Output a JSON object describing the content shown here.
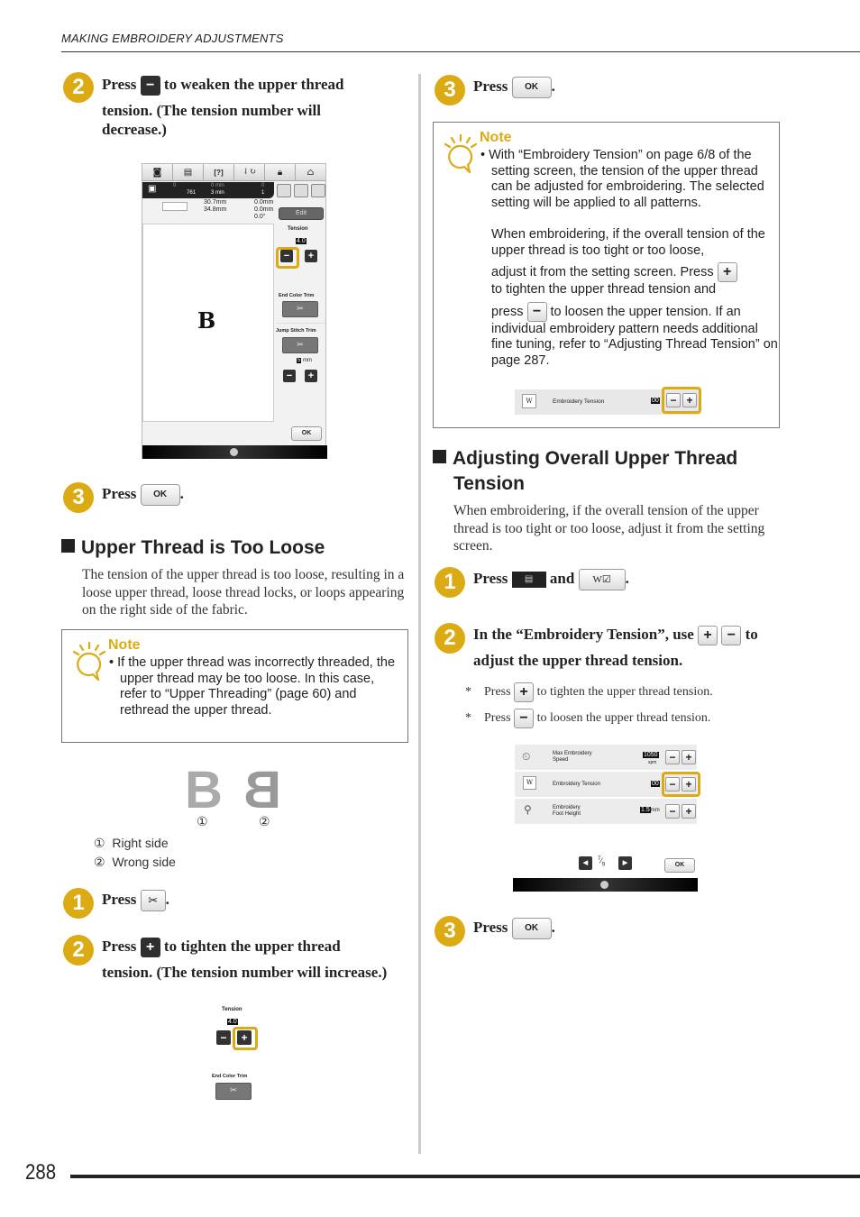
{
  "header": {
    "title": "MAKING EMBROIDERY ADJUSTMENTS"
  },
  "footer": {
    "page_number": "288"
  },
  "left": {
    "step2a": {
      "number": "2",
      "prefix": "Press",
      "icon": "minus-button",
      "line1": "to weaken the upper thread",
      "line2": "tension. (The tension number will",
      "line3": "decrease.)"
    },
    "screen1": {
      "toolbar_icons": [
        "camera-icon",
        "settings-page-icon",
        "help-icon",
        "needle-mode-icon",
        "lock-icon",
        "home-icon"
      ],
      "stitch_count_top": "0",
      "stitch_count_bottom": "761",
      "time_top": "0 min",
      "time_bottom": "3 min",
      "color_top": "0",
      "color_bottom": "1",
      "size_w": "30.7mm",
      "size_h": "34.8mm",
      "offset_v": "0.0mm",
      "offset_h": "0.0mm",
      "rotation": "0.0°",
      "edit_label": "Edit",
      "tension_label": "Tension",
      "tension_value": "4.0",
      "end_color_trim_label": "End Color Trim",
      "jump_stitch_trim_label": "Jump Stitch Trim",
      "jump_value": "5",
      "jump_unit": "mm",
      "pattern_letter": "B",
      "ok_label": "OK",
      "minus": "−",
      "plus": "+"
    },
    "step3a": {
      "number": "3",
      "prefix": "Press",
      "ok_label": "OK",
      "suffix": "."
    },
    "section_loose": {
      "title": "Upper Thread is Too Loose",
      "body": "The tension of the upper thread is too loose, resulting in a loose upper thread, loose thread locks, or loops appearing on the right side of the fabric."
    },
    "note1": {
      "label": "Note",
      "text": "If the upper thread was incorrectly threaded, the upper thread may be too loose. In this case, refer to “Upper Threading” (page 60) and rethread the upper thread."
    },
    "figure": {
      "marker1": "①",
      "marker2": "②",
      "legend": [
        {
          "marker": "①",
          "label": "Right side"
        },
        {
          "marker": "②",
          "label": "Wrong side"
        }
      ]
    },
    "step1b": {
      "number": "1",
      "prefix": "Press",
      "icon": "thread-trim-scissors-button",
      "suffix": "."
    },
    "step2b": {
      "number": "2",
      "prefix": "Press",
      "icon": "plus-button",
      "line1": "to tighten the upper thread",
      "line2": "tension. (The tension number will increase.)"
    },
    "screen2": {
      "tension_label": "Tension",
      "tension_value": "4.0",
      "end_color_trim_label": "End Color Trim",
      "minus": "−",
      "plus": "+"
    }
  },
  "right": {
    "step3c": {
      "number": "3",
      "prefix": "Press",
      "ok_label": "OK",
      "suffix": "."
    },
    "note2": {
      "label": "Note",
      "p1": "With “Embroidery Tension” on page 6/8 of the setting screen, the tension of the upper thread can be adjusted for embroidering. The selected setting will be applied to all patterns.",
      "p2a": "When embroidering, if the overall tension of the upper thread is too tight or too loose,",
      "p2b": "adjust it from the setting screen. Press",
      "p2c": "to tighten the upper thread tension and",
      "p2d": "press",
      "p2e": "to loosen the upper tension. If an",
      "p2f": "individual embroidery pattern needs additional fine tuning, refer to “Adjusting Thread Tension” on page 287.",
      "setting_row_label": "Embroidery Tension",
      "setting_row_value": "00",
      "plus": "+",
      "minus": "−"
    },
    "section_overall": {
      "title_line1": "Adjusting Overall Upper Thread",
      "title_line2": "Tension",
      "body": "When embroidering, if the overall tension of the upper thread is too tight or too loose, adjust it from the setting screen."
    },
    "step1d": {
      "number": "1",
      "prefix": "Press",
      "middle": "and",
      "suffix": "."
    },
    "step2d": {
      "number": "2",
      "line1_a": "In the “Embroidery Tension”, use",
      "line1_b": "to",
      "line2": "adjust the upper thread tension.",
      "bullets": [
        {
          "star": "*",
          "prefix": "Press",
          "icon": "+",
          "text": "to tighten the upper thread tension."
        },
        {
          "star": "*",
          "prefix": "Press",
          "icon": "−",
          "text": "to loosen the upper thread tension."
        }
      ]
    },
    "settings_screen": {
      "rows": [
        {
          "label_line1": "Max Embroidery",
          "label_line2": "Speed",
          "value": "1050",
          "unit": "spm"
        },
        {
          "label_line1": "Embroidery Tension",
          "label_line2": "",
          "value": "00",
          "unit": ""
        },
        {
          "label_line1": "Embroidery",
          "label_line2": "Foot Height",
          "value": "1.5",
          "unit": "mm"
        }
      ],
      "page_num": "7",
      "page_total": "9",
      "ok_label": "OK",
      "minus": "−",
      "plus": "+"
    },
    "step3e": {
      "number": "3",
      "prefix": "Press",
      "ok_label": "OK",
      "suffix": "."
    }
  }
}
